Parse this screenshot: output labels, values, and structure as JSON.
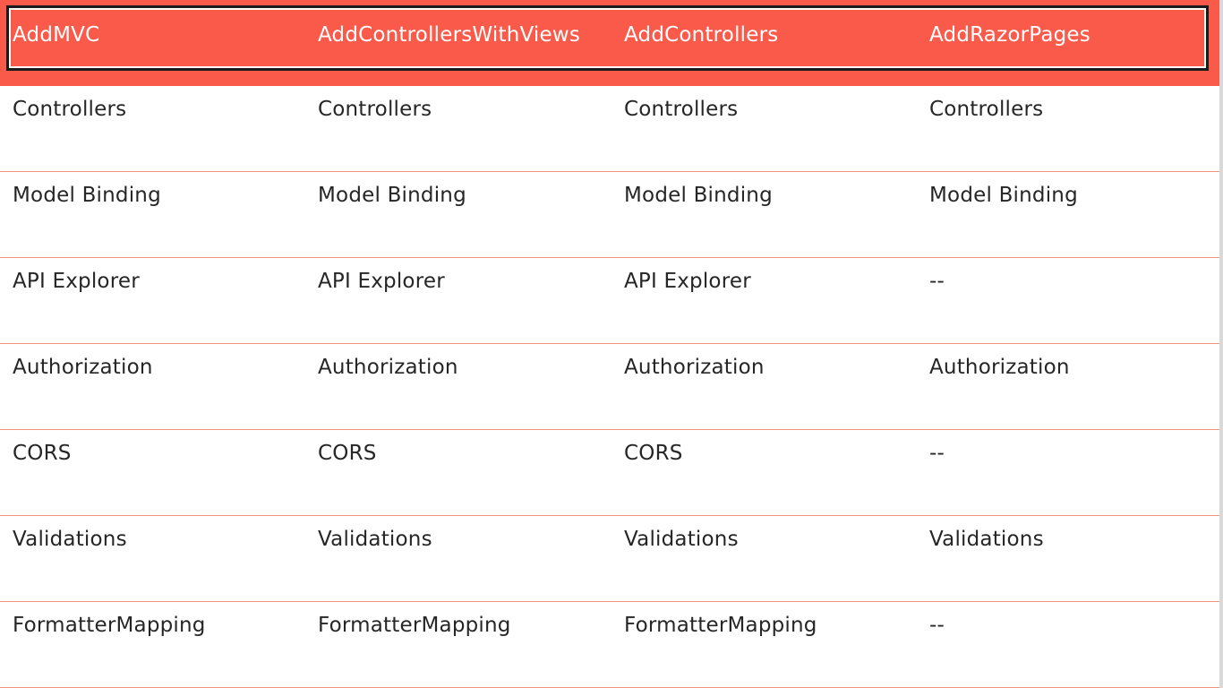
{
  "table": {
    "headers": [
      "AddMVC",
      "AddControllersWithViews",
      "AddControllers",
      "AddRazorPages"
    ],
    "rows": [
      [
        "Controllers",
        "Controllers",
        "Controllers",
        "Controllers"
      ],
      [
        "Model Binding",
        "Model Binding",
        "Model Binding",
        "Model Binding"
      ],
      [
        "API Explorer",
        "API Explorer",
        "API Explorer",
        "--"
      ],
      [
        "Authorization",
        "Authorization",
        "Authorization",
        "Authorization"
      ],
      [
        "CORS",
        "CORS",
        "CORS",
        "--"
      ],
      [
        "Validations",
        "Validations",
        "Validations",
        "Validations"
      ],
      [
        "FormatterMapping",
        "FormatterMapping",
        "FormatterMapping",
        "--"
      ]
    ]
  },
  "colors": {
    "header_background": "#fa5a4a",
    "header_text": "#ffffff",
    "body_text": "#262626",
    "row_divider": "#f0907f"
  }
}
